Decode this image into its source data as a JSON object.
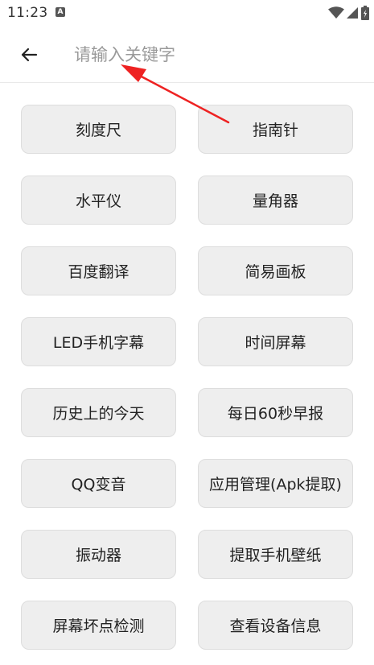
{
  "status_bar": {
    "time": "11:23",
    "notification_icon": "A",
    "icons": [
      "wifi-icon",
      "signal-icon",
      "battery-icon"
    ]
  },
  "header": {
    "search_placeholder": "请输入关键字",
    "back_icon": "arrow-left-icon"
  },
  "tools": [
    {
      "label": "刻度尺"
    },
    {
      "label": "指南针"
    },
    {
      "label": "水平仪"
    },
    {
      "label": "量角器"
    },
    {
      "label": "百度翻译"
    },
    {
      "label": "简易画板"
    },
    {
      "label": "LED手机字幕"
    },
    {
      "label": "时间屏幕"
    },
    {
      "label": "历史上的今天"
    },
    {
      "label": "每日60秒早报"
    },
    {
      "label": "QQ变音"
    },
    {
      "label": "应用管理(Apk提取)"
    },
    {
      "label": "振动器"
    },
    {
      "label": "提取手机壁纸"
    },
    {
      "label": "屏幕坏点检测"
    },
    {
      "label": "查看设备信息"
    }
  ],
  "colors": {
    "button_bg": "#eeeeee",
    "button_border": "#dddddd",
    "annotation_arrow": "#ee2222",
    "placeholder": "#9a9a9a"
  }
}
